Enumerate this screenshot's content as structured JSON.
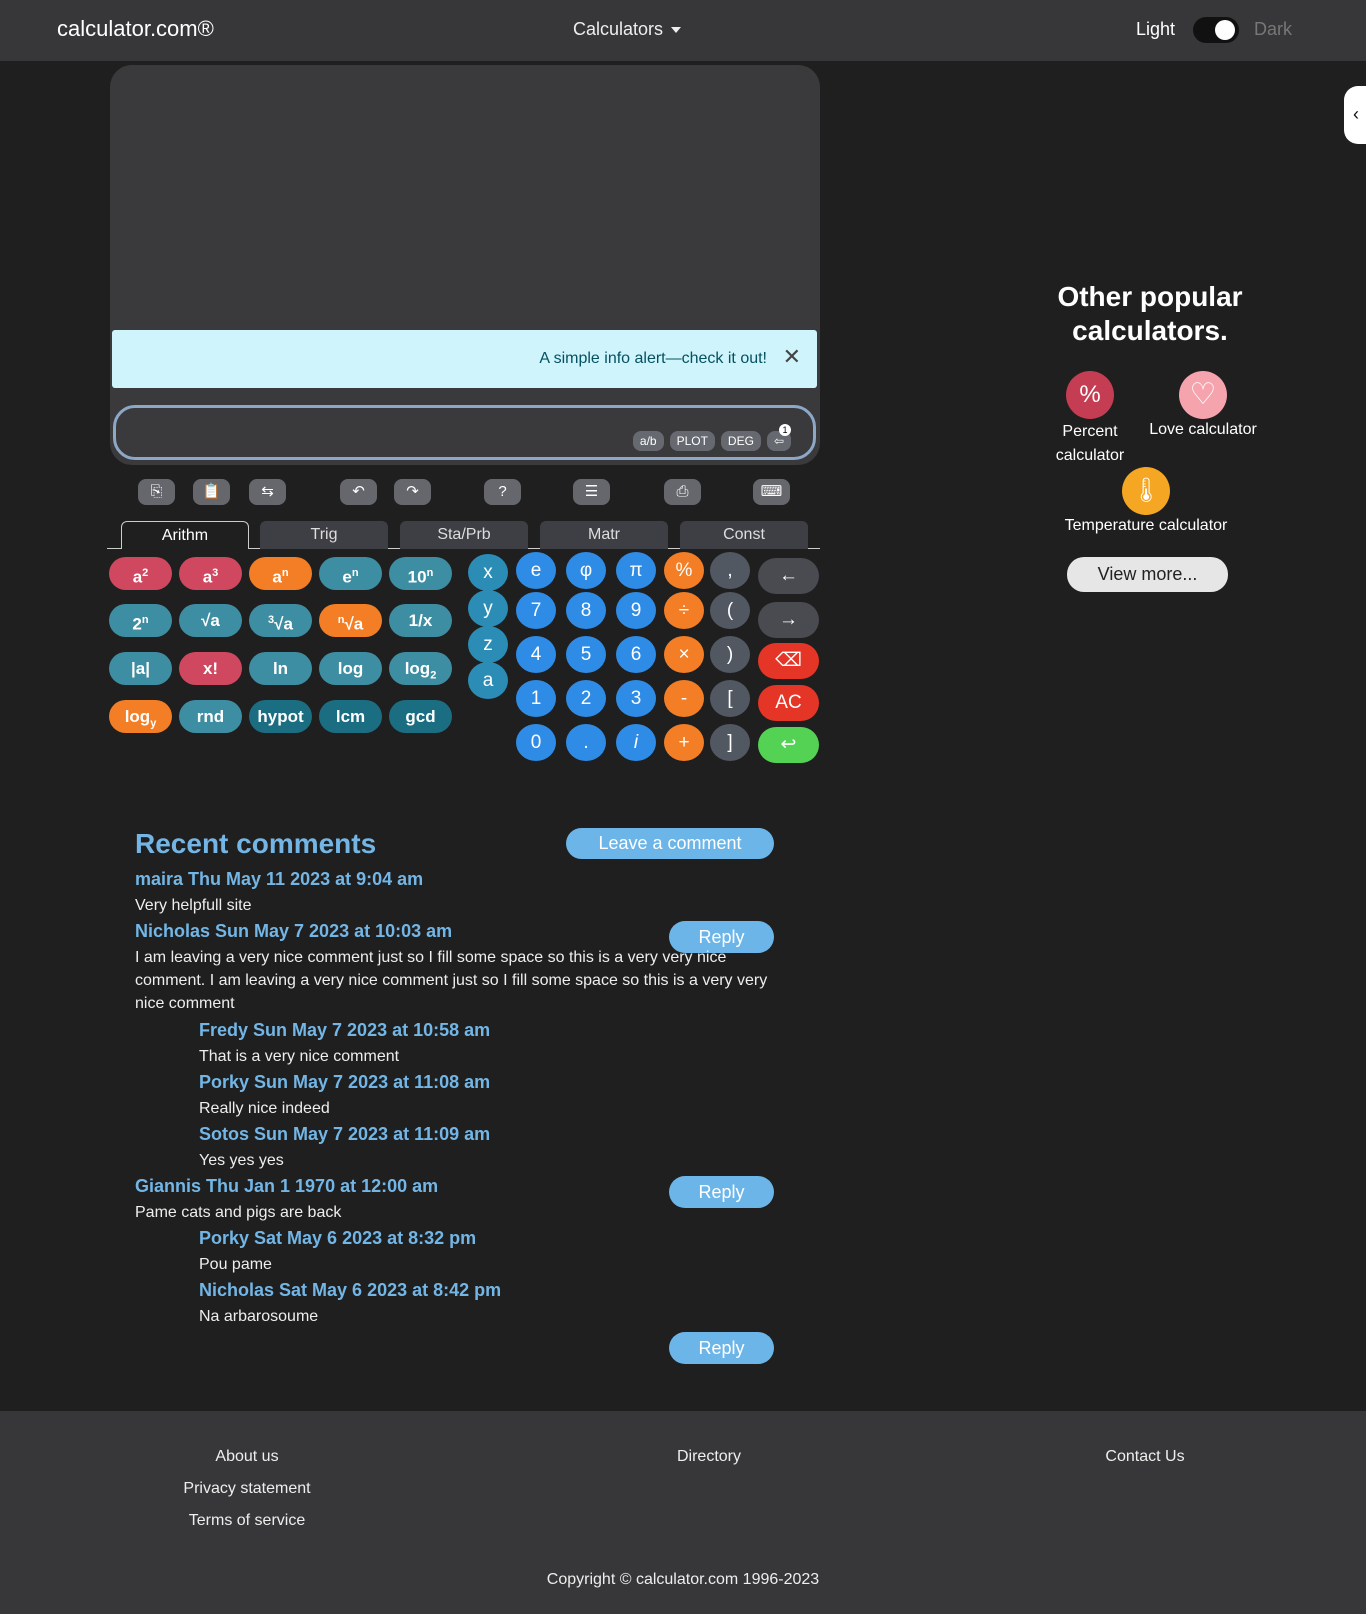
{
  "nav": {
    "brand": "calculator.com®",
    "menu": "Calculators",
    "light": "Light",
    "dark": "Dark"
  },
  "alert": {
    "text": "A simple info alert—check it out!",
    "close": "✕"
  },
  "input": {
    "chips": [
      "a/b",
      "PLOT",
      "DEG"
    ],
    "badge": "1"
  },
  "tabs": [
    "Arithm",
    "Trig",
    "Sta/Prb",
    "Matr",
    "Const"
  ],
  "sidebar": {
    "title_line1": "Other popular",
    "title_line2": "calculators.",
    "items": [
      {
        "line1": "Percent",
        "line2": "calculator",
        "icon": "%",
        "color": "#c43d52"
      },
      {
        "label": "Love calculator",
        "icon": "♡",
        "color": "#f5a3ad"
      },
      {
        "label": "Temperature calculator",
        "icon": "🌡",
        "color": "#f5a623"
      }
    ],
    "view_more": "View more..."
  },
  "keys": {
    "numbers": [
      "e",
      "φ",
      "π",
      "7",
      "8",
      "9",
      "4",
      "5",
      "6",
      "1",
      "2",
      "3",
      "0",
      ".",
      "i"
    ],
    "ops": [
      "%",
      "÷",
      "×",
      "-",
      "+"
    ],
    "brackets": [
      ",",
      "(",
      ")",
      "[",
      "]"
    ],
    "vars": [
      "x",
      "y",
      "z",
      "a"
    ],
    "actions": [
      "←",
      "→",
      "⌫",
      "AC",
      "↩"
    ],
    "func_plain": {
      "inv": "1/x",
      "abs": "|a|",
      "fact": "x!",
      "ln": "ln",
      "log": "log",
      "rnd": "rnd",
      "hypot": "hypot",
      "lcm": "lcm",
      "gcd": "gcd"
    }
  },
  "comments": {
    "title": "Recent comments",
    "leave": "Leave a comment",
    "reply": "Reply",
    "list": [
      {
        "author": "maira Thu May 11 2023 at 9:04 am",
        "text": "Very helpfull site"
      },
      {
        "author": "Nicholas Sun May 7 2023 at 10:03 am",
        "text": "I am leaving a very nice comment just so I fill some space so this is a very very nice comment. I am leaving a very nice comment just so I fill some space so this is a very very nice comment"
      },
      {
        "author": "Fredy Sun May 7 2023 at 10:58 am",
        "text": "That is a very nice comment"
      },
      {
        "author": "Porky Sun May 7 2023 at 11:08 am",
        "text": "Really nice indeed"
      },
      {
        "author": "Sotos Sun May 7 2023 at 11:09 am",
        "text": "Yes yes yes"
      },
      {
        "author": "Giannis Thu Jan 1 1970 at 12:00 am",
        "text": "Pame cats and pigs are back"
      },
      {
        "author": "Porky Sat May 6 2023 at 8:32 pm",
        "text": "Pou pame"
      },
      {
        "author": "Nicholas Sat May 6 2023 at 8:42 pm",
        "text": "Na arbarosoume"
      }
    ]
  },
  "footer": {
    "about": "About us",
    "privacy": "Privacy statement",
    "terms": "Terms of service",
    "directory": "Directory",
    "contact": "Contact Us",
    "copyright": "Copyright © calculator.com 1996-2023"
  }
}
